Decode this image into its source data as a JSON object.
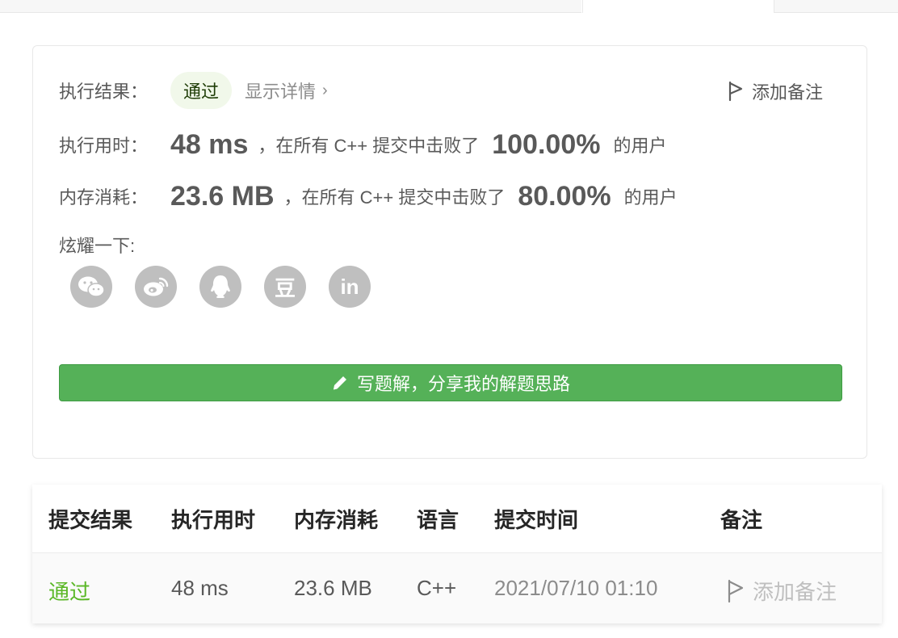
{
  "result": {
    "label": "执行结果：",
    "status": "通过",
    "details_link": "显示详情",
    "add_note": "添加备注",
    "runtime_label": "执行用时：",
    "runtime_value": "48 ms",
    "runtime_text": "，在所有 C++ 提交中击败了",
    "runtime_percent": "100.00%",
    "runtime_suffix": "的用户",
    "memory_label": "内存消耗：",
    "memory_value": "23.6 MB",
    "memory_text": "，在所有 C++ 提交中击败了",
    "memory_percent": "80.00%",
    "memory_suffix": "的用户",
    "share_label": "炫耀一下:",
    "share_icons": [
      "wechat-icon",
      "weibo-icon",
      "qq-icon",
      "douban-icon",
      "linkedin-icon"
    ],
    "share_glyphs": {
      "douban": "豆",
      "linkedin": "in"
    },
    "write_solution": "写题解，分享我的解题思路"
  },
  "table": {
    "headers": [
      "提交结果",
      "执行用时",
      "内存消耗",
      "语言",
      "提交时间",
      "备注"
    ],
    "rows": [
      {
        "status": "通过",
        "runtime": "48 ms",
        "memory": "23.6 MB",
        "language": "C++",
        "submitted_at": "2021/07/10 01:10",
        "note": "添加备注"
      }
    ]
  },
  "colors": {
    "accent_green": "#5ab726",
    "button_green": "#55b158",
    "badge_bg": "#f1f8ea",
    "icon_gray": "#bfbfbf"
  }
}
